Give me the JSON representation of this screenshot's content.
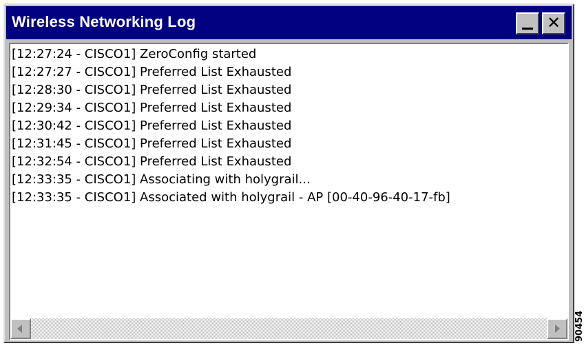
{
  "window": {
    "title": "Wireless Networking Log",
    "minimize_icon": "minimize-icon",
    "close_glyph": "✕"
  },
  "log": {
    "entries": [
      "[12:27:24 - CISCO1]  ZeroConfig started",
      "[12:27:27 - CISCO1]  Preferred List Exhausted",
      "[12:28:30 - CISCO1]  Preferred List Exhausted",
      "[12:29:34 - CISCO1]  Preferred List Exhausted",
      "[12:30:42 - CISCO1]  Preferred List Exhausted",
      "[12:31:45 - CISCO1]  Preferred List Exhausted",
      "[12:32:54 - CISCO1]  Preferred List Exhausted",
      "[12:33:35 - CISCO1]  Associating with holygrail...",
      "[12:33:35 - CISCO1]  Associated with holygrail - AP [00-40-96-40-17-fb]"
    ]
  },
  "scrollbar": {
    "left_icon": "scroll-left-arrow-icon",
    "right_icon": "scroll-right-arrow-icon"
  },
  "figure_id": "90454",
  "colors": {
    "titlebar": "#000080",
    "title_text": "#ffffff",
    "face": "#c0c0c0"
  }
}
